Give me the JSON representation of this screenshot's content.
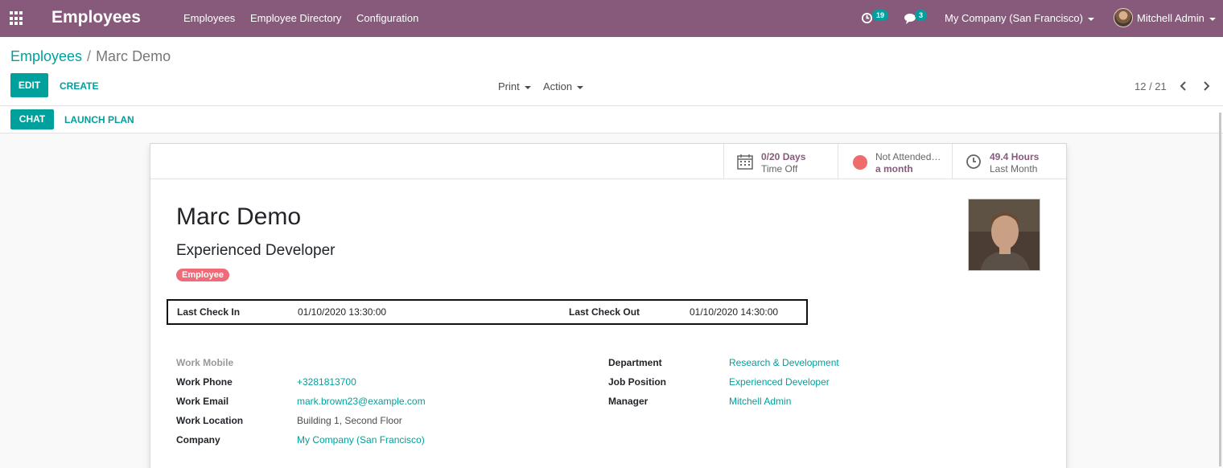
{
  "navbar": {
    "app_title": "Employees",
    "menu": [
      "Employees",
      "Employee Directory",
      "Configuration"
    ],
    "activity_count": "19",
    "message_count": "3",
    "company": "My Company (San Francisco)",
    "user": "Mitchell Admin"
  },
  "breadcrumb": {
    "parent": "Employees",
    "separator": "/",
    "current": "Marc Demo"
  },
  "toolbar": {
    "edit": "EDIT",
    "create": "CREATE",
    "print": "Print",
    "action": "Action",
    "pager": "12 / 21"
  },
  "statusbar": {
    "chat": "CHAT",
    "launch_plan": "LAUNCH PLAN"
  },
  "smart_buttons": {
    "time_off": {
      "value": "0/20 Days",
      "label": "Time Off"
    },
    "attendance": {
      "value": "Not Attended…",
      "label": "a month"
    },
    "hours": {
      "value": "49.4 Hours",
      "label": "Last Month"
    }
  },
  "employee": {
    "name": "Marc Demo",
    "job_title": "Experienced Developer",
    "tag": "Employee"
  },
  "attendance": {
    "check_in_label": "Last Check In",
    "check_in_value": "01/10/2020 13:30:00",
    "check_out_label": "Last Check Out",
    "check_out_value": "01/10/2020 14:30:00"
  },
  "fields_left": {
    "work_mobile_label": "Work Mobile",
    "work_phone_label": "Work Phone",
    "work_phone": "+3281813700",
    "work_email_label": "Work Email",
    "work_email": "mark.brown23@example.com",
    "work_location_label": "Work Location",
    "work_location": "Building 1, Second Floor",
    "company_label": "Company",
    "company": "My Company (San Francisco)"
  },
  "fields_right": {
    "department_label": "Department",
    "department": "Research & Development",
    "job_position_label": "Job Position",
    "job_position": "Experienced Developer",
    "manager_label": "Manager",
    "manager": "Mitchell Admin"
  },
  "colors": {
    "navbar": "#875a7b",
    "accent": "#00a09d",
    "tag": "#f06b78"
  }
}
